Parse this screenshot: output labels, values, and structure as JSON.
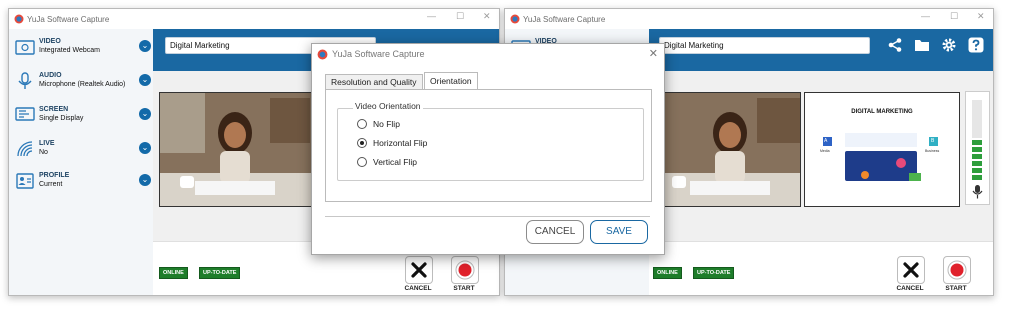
{
  "app": {
    "title": "YuJa Software Capture"
  },
  "window_controls": {
    "minimize": "—",
    "maximize": "☐",
    "close": "✕"
  },
  "sidebar": {
    "items": [
      {
        "title": "VIDEO",
        "subtitle": "Integrated Webcam",
        "icon": "webcam-icon"
      },
      {
        "title": "AUDIO",
        "subtitle": "Microphone (Realtek Audio)",
        "icon": "microphone-icon"
      },
      {
        "title": "SCREEN",
        "subtitle": "Single Display",
        "icon": "screen-icon"
      },
      {
        "title": "LIVE",
        "subtitle": "No",
        "icon": "live-icon"
      },
      {
        "title": "PROFILE",
        "subtitle": "Current",
        "icon": "profile-icon"
      }
    ],
    "expand_glyph": "⌄"
  },
  "recording": {
    "name": "Digital Marketing"
  },
  "status": {
    "online": "ONLINE",
    "up_to_date": "UP-TO-DATE"
  },
  "actions": {
    "cancel": "CANCEL",
    "start": "START"
  },
  "slide": {
    "title": "DIGITAL MARKETING",
    "left_box": "A",
    "right_box": "B",
    "left_caption": "Media",
    "right_caption": "Business"
  },
  "dialog": {
    "title": "YuJa Software Capture",
    "close": "✕",
    "tabs": [
      "Resolution and Quality",
      "Orientation"
    ],
    "group_label": "Video Orientation",
    "options": [
      "No Flip",
      "Horizontal Flip",
      "Vertical Flip"
    ],
    "selected_option": "Horizontal Flip",
    "cancel": "CANCEL",
    "save": "SAVE"
  },
  "colors": {
    "accent": "#1a68a2",
    "online": "#1e7d2a",
    "start_red": "#e0212b",
    "meter_green": "#2e9e3c"
  }
}
